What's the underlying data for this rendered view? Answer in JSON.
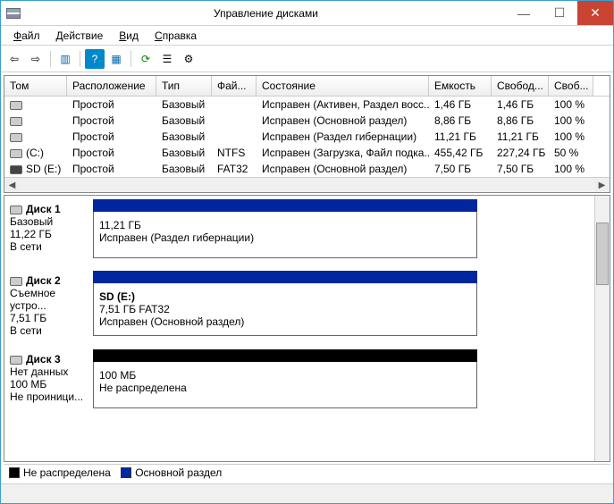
{
  "window": {
    "title": "Управление дисками"
  },
  "menu": {
    "file": "Файл",
    "action": "Действие",
    "view": "Вид",
    "help": "Справка"
  },
  "columns": {
    "vol": "Том",
    "loc": "Расположение",
    "type": "Тип",
    "fs": "Фай...",
    "status": "Состояние",
    "cap": "Емкость",
    "free": "Свобод...",
    "pct": "Своб..."
  },
  "rows": [
    {
      "vol": "",
      "icon": "fixed",
      "loc": "Простой",
      "type": "Базовый",
      "fs": "",
      "status": "Исправен (Активен, Раздел восс...",
      "cap": "1,46 ГБ",
      "free": "1,46 ГБ",
      "pct": "100 %"
    },
    {
      "vol": "",
      "icon": "fixed",
      "loc": "Простой",
      "type": "Базовый",
      "fs": "",
      "status": "Исправен (Основной раздел)",
      "cap": "8,86 ГБ",
      "free": "8,86 ГБ",
      "pct": "100 %"
    },
    {
      "vol": "",
      "icon": "fixed",
      "loc": "Простой",
      "type": "Базовый",
      "fs": "",
      "status": "Исправен (Раздел гибернации)",
      "cap": "11,21 ГБ",
      "free": "11,21 ГБ",
      "pct": "100 %"
    },
    {
      "vol": "(C:)",
      "icon": "fixed",
      "loc": "Простой",
      "type": "Базовый",
      "fs": "NTFS",
      "status": "Исправен (Загрузка, Файл подка...",
      "cap": "455,42 ГБ",
      "free": "227,24 ГБ",
      "pct": "50 %"
    },
    {
      "vol": "SD (E:)",
      "icon": "removable",
      "loc": "Простой",
      "type": "Базовый",
      "fs": "FAT32",
      "status": "Исправен (Основной раздел)",
      "cap": "7,50 ГБ",
      "free": "7,50 ГБ",
      "pct": "100 %"
    }
  ],
  "disks": [
    {
      "name": "Диск 1",
      "type": "Базовый",
      "size": "11,22 ГБ",
      "state": "В сети",
      "p_hdr": "primary",
      "p_title": "",
      "p_line1": "11,21 ГБ",
      "p_line2": "Исправен (Раздел гибернации)"
    },
    {
      "name": "Диск 2",
      "type": "Съемное устро...",
      "size": "7,51 ГБ",
      "state": "В сети",
      "p_hdr": "primary",
      "p_title": "SD  (E:)",
      "p_line1": "7,51 ГБ FAT32",
      "p_line2": "Исправен (Основной раздел)"
    },
    {
      "name": "Диск 3",
      "type": "Нет данных",
      "size": "100 МБ",
      "state": "Не проиници...",
      "p_hdr": "unalloc",
      "p_title": "",
      "p_line1": "100 МБ",
      "p_line2": "Не распределена"
    }
  ],
  "legend": {
    "unalloc": "Не распределена",
    "primary": "Основной раздел"
  }
}
